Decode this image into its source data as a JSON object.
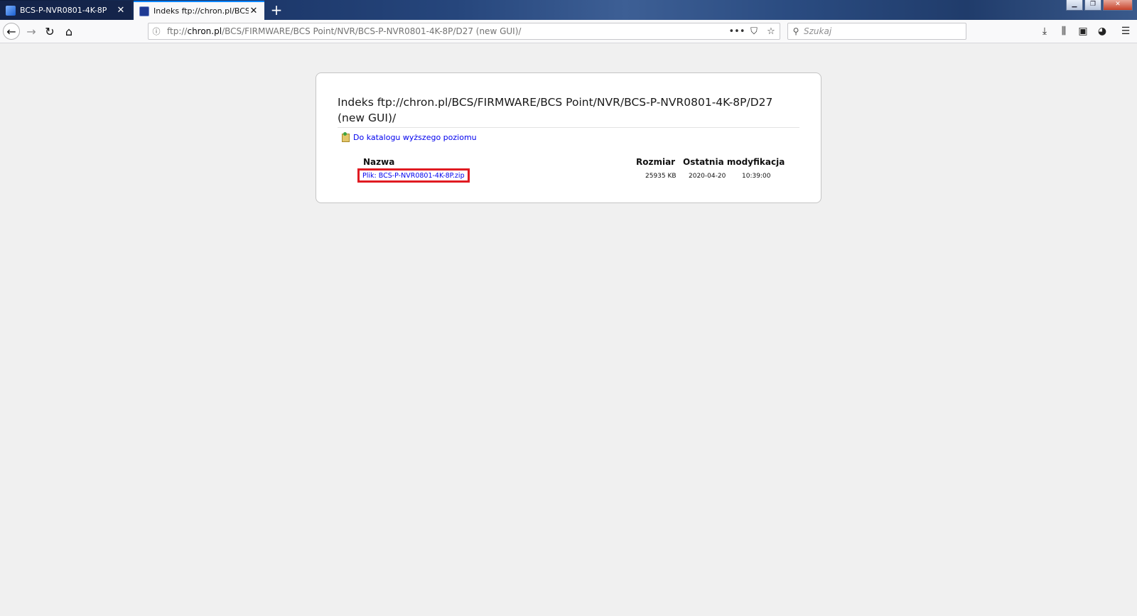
{
  "browser": {
    "tabs": [
      {
        "title": "BCS-P-NVR0801-4K-8P",
        "active": false
      },
      {
        "title": "Indeks ftp://chron.pl/BCS/FIRM",
        "active": true
      }
    ],
    "address": {
      "scheme": "ftp://",
      "host": "chron.pl",
      "path": "/BCS/FIRMWARE/BCS Point/NVR/BCS-P-NVR0801-4K-8P/D27 (new GUI)/"
    },
    "search_placeholder": "Szukaj",
    "accent_color": "#0a84ff"
  },
  "page": {
    "heading": "Indeks ftp://chron.pl/BCS/FIRMWARE/BCS Point/NVR/BCS-P-NVR0801-4K-8P/D27 (new GUI)/",
    "up_link": "Do katalogu wyższego poziomu",
    "columns": {
      "name": "Nazwa",
      "size": "Rozmiar",
      "modified": "Ostatnia modyfikacja"
    },
    "files": [
      {
        "prefix": "Plik:",
        "name": "BCS-P-NVR0801-4K-8P.zip",
        "size": "25935 KB",
        "date": "2020-04-20",
        "time": "10:39:00"
      }
    ],
    "highlight_color": "#e01b22"
  }
}
